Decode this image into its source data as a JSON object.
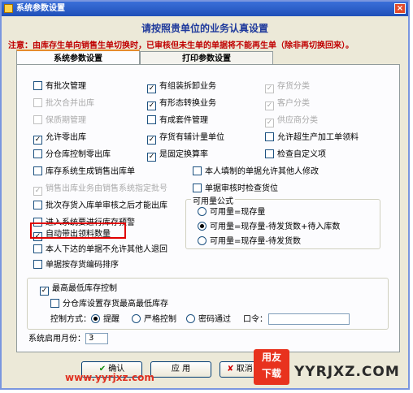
{
  "window": {
    "title": "系统参数设置",
    "close_glyph": "×"
  },
  "heading": "请按照贵单位的业务认真设置",
  "notice": "注意：由库存生单向销售生单切换时，已审核但未生单的单据将不能再生单（除非再切换回来）。",
  "tabs": [
    {
      "label": "系统参数设置",
      "active": true
    },
    {
      "label": "打印参数设置",
      "active": false
    }
  ],
  "options": {
    "batch_mgmt": {
      "label": "有批次管理",
      "checked": false,
      "enabled": true
    },
    "batch_merge_out": {
      "label": "批次合并出库",
      "checked": false,
      "enabled": false
    },
    "shelf_life_mgmt": {
      "label": "保质期管理",
      "checked": false,
      "enabled": false
    },
    "allow_zero_out": {
      "label": "允许零出库",
      "checked": true,
      "enabled": true
    },
    "partition_zero_out": {
      "label": "分仓库控制零出库",
      "checked": false,
      "enabled": true
    },
    "stock_gen_sales_out": {
      "label": "库存系统生成销售出库单",
      "checked": false,
      "enabled": true
    },
    "sales_out_by_sales": {
      "label": "销售出库业务由销售系统指定批号",
      "checked": true,
      "enabled": false
    },
    "batch_in_after_audit": {
      "label": "批次存货入库单审核之后才能出库",
      "checked": false,
      "enabled": true
    },
    "enter_system_alert": {
      "label": "进入系统要进行库存预警",
      "checked": false,
      "enabled": true
    },
    "auto_issue_qty": {
      "label": "自动带出领料数量",
      "checked": true,
      "enabled": true
    },
    "no_others_reject": {
      "label": "本人下达的单据不允许其他人退回",
      "checked": false,
      "enabled": true
    },
    "sort_by_inventory_code": {
      "label": "单据按存货编码排序",
      "checked": false,
      "enabled": true
    },
    "assembly_biz": {
      "label": "有组装拆卸业务",
      "checked": true,
      "enabled": true
    },
    "form_convert_biz": {
      "label": "有形态转换业务",
      "checked": true,
      "enabled": true
    },
    "kit_mgmt": {
      "label": "有成套件管理",
      "checked": false,
      "enabled": true
    },
    "aux_unit": {
      "label": "存货有辅计量单位",
      "checked": true,
      "enabled": true
    },
    "fixed_rate": {
      "label": "是固定换算率",
      "checked": true,
      "enabled": true
    },
    "inventory_class": {
      "label": "存货分类",
      "checked": true,
      "enabled": false
    },
    "customer_class": {
      "label": "客户分类",
      "checked": true,
      "enabled": false
    },
    "supplier_class": {
      "label": "供应商分类",
      "checked": true,
      "enabled": false
    },
    "allow_over_production": {
      "label": "允许超生产加工单领料",
      "checked": false,
      "enabled": true
    },
    "check_custom_items": {
      "label": "检查自定义项",
      "checked": false,
      "enabled": true
    },
    "no_others_modify": {
      "label": "本人填制的单据允许其他人修改",
      "checked": false,
      "enabled": true
    },
    "check_location_on_audit": {
      "label": "单据审核时检查货位",
      "checked": false,
      "enabled": true
    }
  },
  "available_formula": {
    "label": "可用量公式",
    "choices": [
      {
        "label": "可用量=现存量",
        "selected": false
      },
      {
        "label": "可用量=现存量-待发货数+待入库数",
        "selected": true
      },
      {
        "label": "可用量=现存量-待发货数",
        "selected": false
      }
    ]
  },
  "max_min_stock": {
    "label": "最高最低库存控制",
    "checked": true,
    "partition_label": "分仓库设置存货最高最低库存",
    "partition_checked": false,
    "control_mode_label": "控制方式：",
    "modes": [
      {
        "label": "提醒",
        "selected": true
      },
      {
        "label": "严格控制",
        "selected": false
      },
      {
        "label": "密码通过",
        "selected": false
      }
    ],
    "password_label": "口令：",
    "password_value": ""
  },
  "enable_month": {
    "label": "系统启用月份：",
    "value": "3"
  },
  "buttons": {
    "ok": "确认",
    "apply": "应 用",
    "cancel": "取消",
    "ok_glyph": "✔",
    "cancel_glyph": "✘"
  },
  "watermarks": {
    "site": "www.yyrjxz.com",
    "logo_top": "用友",
    "logo_bottom": "下载",
    "brand": "YYRJXZ.COM"
  },
  "colors": {
    "title_bar": "#1f4fb8",
    "heading": "#1f3a9c",
    "notice": "#c00000",
    "highlight": "#e00000",
    "watermark": "#e03020"
  }
}
